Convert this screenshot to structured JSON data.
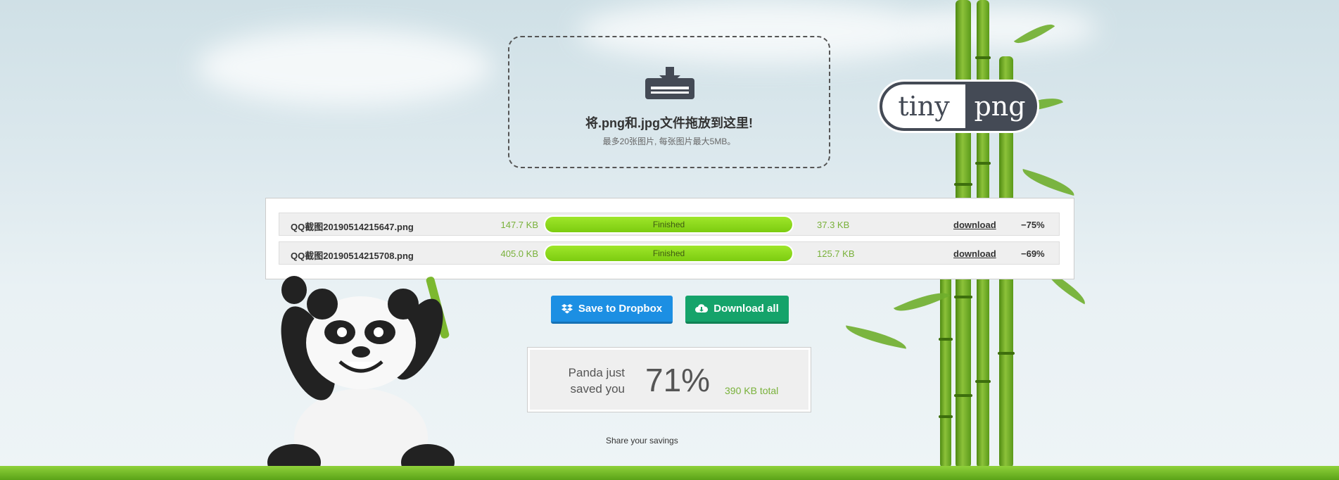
{
  "dropzone": {
    "title": "将.png和.jpg文件拖放到这里!",
    "subtitle": "最多20张图片, 每张图片最大5MB。"
  },
  "logo": {
    "left": "tiny",
    "right": "png"
  },
  "files": [
    {
      "name": "QQ截图20190514215647.png",
      "original_size": "147.7 KB",
      "status": "Finished",
      "progress": 100,
      "new_size": "37.3 KB",
      "download_label": "download",
      "savings": "−75%"
    },
    {
      "name": "QQ截图20190514215708.png",
      "original_size": "405.0 KB",
      "status": "Finished",
      "progress": 100,
      "new_size": "125.7 KB",
      "download_label": "download",
      "savings": "−69%"
    }
  ],
  "actions": {
    "dropbox_label": "Save to Dropbox",
    "download_all_label": "Download all",
    "dropbox_icon": "dropbox-icon",
    "download_all_icon": "cloud-download-icon"
  },
  "summary": {
    "text": "Panda just saved you",
    "percent": "71%",
    "total": "390 KB total"
  },
  "share_label": "Share your savings",
  "colors": {
    "accent_green": "#79b13a",
    "progress_green": "#8fd81c",
    "dropbox_blue": "#1c8fe3",
    "download_green": "#15a36a",
    "logo_dark": "#444a55"
  }
}
